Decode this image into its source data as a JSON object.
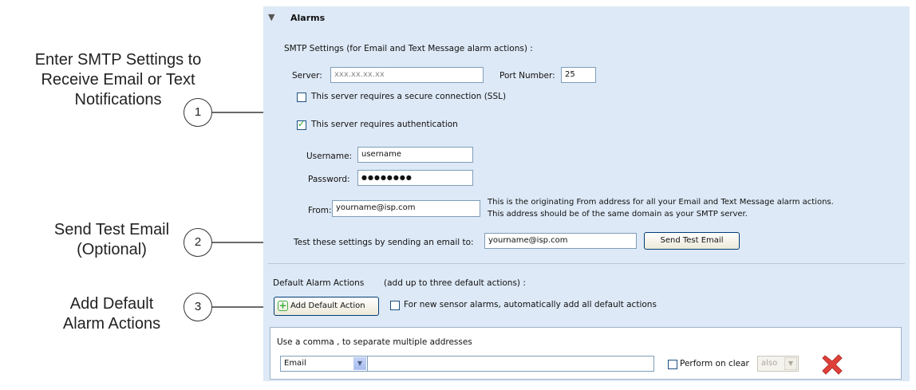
{
  "callouts": [
    {
      "number": "1",
      "text": "Enter SMTP Settings to Receive Email or Text Notifications"
    },
    {
      "number": "2",
      "text": "Send Test Email (Optional)"
    },
    {
      "number": "3",
      "text": "Add Default Alarm Actions"
    }
  ],
  "callout_lines": [
    [
      "Enter SMTP Settings to",
      "Receive Email or Text",
      "Notifications"
    ],
    [
      "Send Test Email",
      "(Optional)"
    ],
    [
      "Add Default",
      "Alarm Actions"
    ]
  ],
  "section": {
    "toggle_glyph": "▼",
    "title": "Alarms"
  },
  "smtp": {
    "heading": "SMTP Settings",
    "heading_note": " (for Email and Text Message alarm actions) :",
    "server_label": "Server:",
    "server_placeholder": "xxx.xx.xx.xx",
    "port_label": "Port Number:",
    "port_value": "25",
    "ssl_label": "This server requires a secure connection (SSL)",
    "ssl_checked": false,
    "auth_label": "This server requires authentication",
    "auth_checked": true,
    "username_label": "Username:",
    "username_value": "username",
    "password_label": "Password:",
    "password_value": "●●●●●●●●",
    "from_label": "From:",
    "from_value": "yourname@isp.com",
    "from_help_line1": "This is the originating From address for all your Email and Text Message alarm actions.",
    "from_help_line2": "This address should be of the same domain as your SMTP server."
  },
  "test": {
    "label": "Test these settings by sending an email to:",
    "value": "yourname@isp.com",
    "button": "Send Test Email"
  },
  "defaults": {
    "heading": "Default Alarm Actions",
    "note": "(add up to three default actions) :",
    "add_button": "Add Default Action",
    "auto_add_label": "For new sensor alarms, automatically add all default actions",
    "auto_add_checked": false,
    "hint": "Use a comma , to separate multiple addresses",
    "action_type": "Email",
    "address_value": "",
    "perform_on_clear_label": "Perform on clear",
    "perform_on_clear_checked": false,
    "also_value": "also"
  },
  "colors": {
    "panel_bg": "#dde9f6",
    "delete_icon": "#e0403a",
    "plus_icon": "#3cae3c"
  },
  "icons": [
    "collapse-triangle-icon",
    "checkmark-icon",
    "plus-icon",
    "dropdown-arrow-icon",
    "delete-x-icon"
  ]
}
